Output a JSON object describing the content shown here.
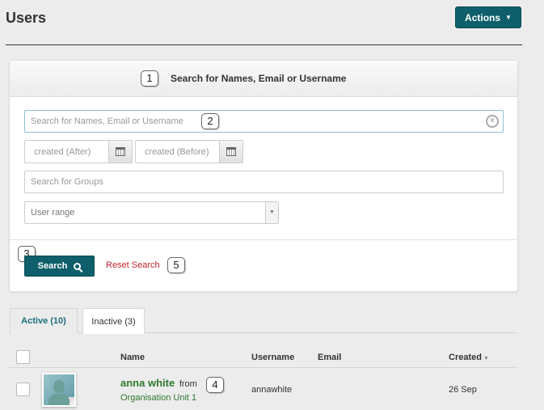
{
  "page": {
    "title": "Users"
  },
  "header": {
    "actions_label": "Actions"
  },
  "search_panel": {
    "heading": "Search for Names, Email or Username",
    "search_placeholder": "Search for Names, Email or Username",
    "created_after_placeholder": "created (After)",
    "created_before_placeholder": "created (Before)",
    "groups_placeholder": "Search for Groups",
    "user_range_selected": "User range",
    "search_button_label": "Search",
    "reset_link_label": "Reset Search"
  },
  "callouts": [
    "1",
    "2",
    "3",
    "4",
    "5"
  ],
  "tabs": [
    {
      "label": "Active (10)",
      "active": true
    },
    {
      "label": "Inactive (3)",
      "active": false
    }
  ],
  "table": {
    "columns": [
      "Name",
      "Username",
      "Email",
      "Created"
    ],
    "rows": [
      {
        "name": "anna white",
        "from_text": "from",
        "organisation": "Organisation Unit 1",
        "username": "annawhite",
        "email": "",
        "created": "26 Sep"
      }
    ]
  },
  "colors": {
    "accent": "#0e5f6b",
    "link_red": "#c0202e",
    "name_green": "#2f7a2f"
  },
  "icons": [
    "caret-down-icon",
    "clear-icon",
    "calendar-icon",
    "magnifier-icon",
    "select-arrow-icon",
    "sort-down-icon",
    "avatar-icon"
  ]
}
